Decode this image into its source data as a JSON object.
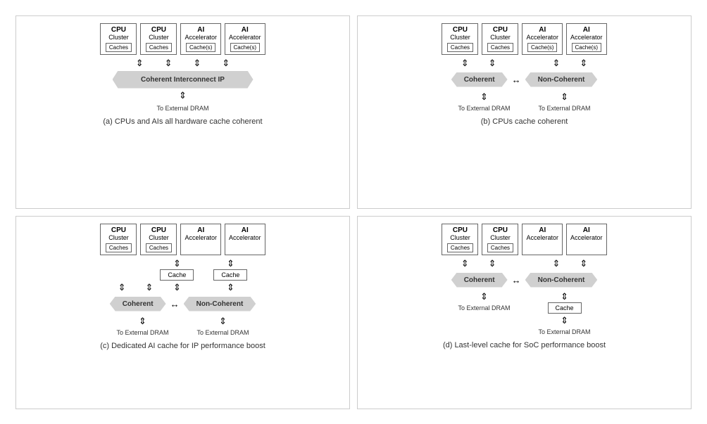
{
  "diagrams": [
    {
      "id": "a",
      "title": "(a) CPUs and AIs all hardware cache coherent",
      "units": [
        {
          "title": "CPU",
          "sub": "Cluster",
          "cache": "Caches"
        },
        {
          "title": "CPU",
          "sub": "Cluster",
          "cache": "Caches"
        },
        {
          "title": "AI",
          "sub": "Accelerator",
          "cache": "Cache(s)"
        },
        {
          "title": "AI",
          "sub": "Accelerator",
          "cache": "Cache(s)"
        }
      ],
      "interconnect": "Coherent Interconnect IP",
      "type": "single-banner",
      "dram_labels": [
        "To External DRAM"
      ]
    },
    {
      "id": "b",
      "title": "(b) CPUs cache coherent",
      "units": [
        {
          "title": "CPU",
          "sub": "Cluster",
          "cache": "Caches"
        },
        {
          "title": "CPU",
          "sub": "Cluster",
          "cache": "Caches"
        },
        {
          "title": "AI",
          "sub": "Accelerator",
          "cache": "Cache(s)"
        },
        {
          "title": "AI",
          "sub": "Accelerator",
          "cache": "Cache(s)"
        }
      ],
      "type": "dual-banner",
      "banner1": "Coherent",
      "banner2": "Non-Coherent",
      "dram_labels": [
        "To External DRAM",
        "To External DRAM"
      ]
    },
    {
      "id": "c",
      "title": "(c) Dedicated AI cache for IP performance boost",
      "units": [
        {
          "title": "CPU",
          "sub": "Cluster",
          "cache": "Caches"
        },
        {
          "title": "CPU",
          "sub": "Cluster",
          "cache": "Caches"
        },
        {
          "title": "AI",
          "sub": "Accelerator",
          "cache": ""
        },
        {
          "title": "AI",
          "sub": "Accelerator",
          "cache": ""
        }
      ],
      "type": "dual-banner-mid-cache",
      "banner1": "Coherent",
      "banner2": "Non-Coherent",
      "mid_cache": "Cache",
      "dram_labels": [
        "To External DRAM",
        "To External DRAM"
      ]
    },
    {
      "id": "d",
      "title": "(d) Last-level cache for SoC performance boost",
      "units": [
        {
          "title": "CPU",
          "sub": "Cluster",
          "cache": "Caches"
        },
        {
          "title": "CPU",
          "sub": "Cluster",
          "cache": "Caches"
        },
        {
          "title": "AI",
          "sub": "Accelerator",
          "cache": ""
        },
        {
          "title": "AI",
          "sub": "Accelerator",
          "cache": ""
        }
      ],
      "type": "dual-banner-bottom-cache",
      "banner1": "Coherent",
      "banner2": "Non-Coherent",
      "bottom_cache": "Cache",
      "dram_labels": [
        "To External DRAM",
        "To External DRAM"
      ]
    }
  ]
}
